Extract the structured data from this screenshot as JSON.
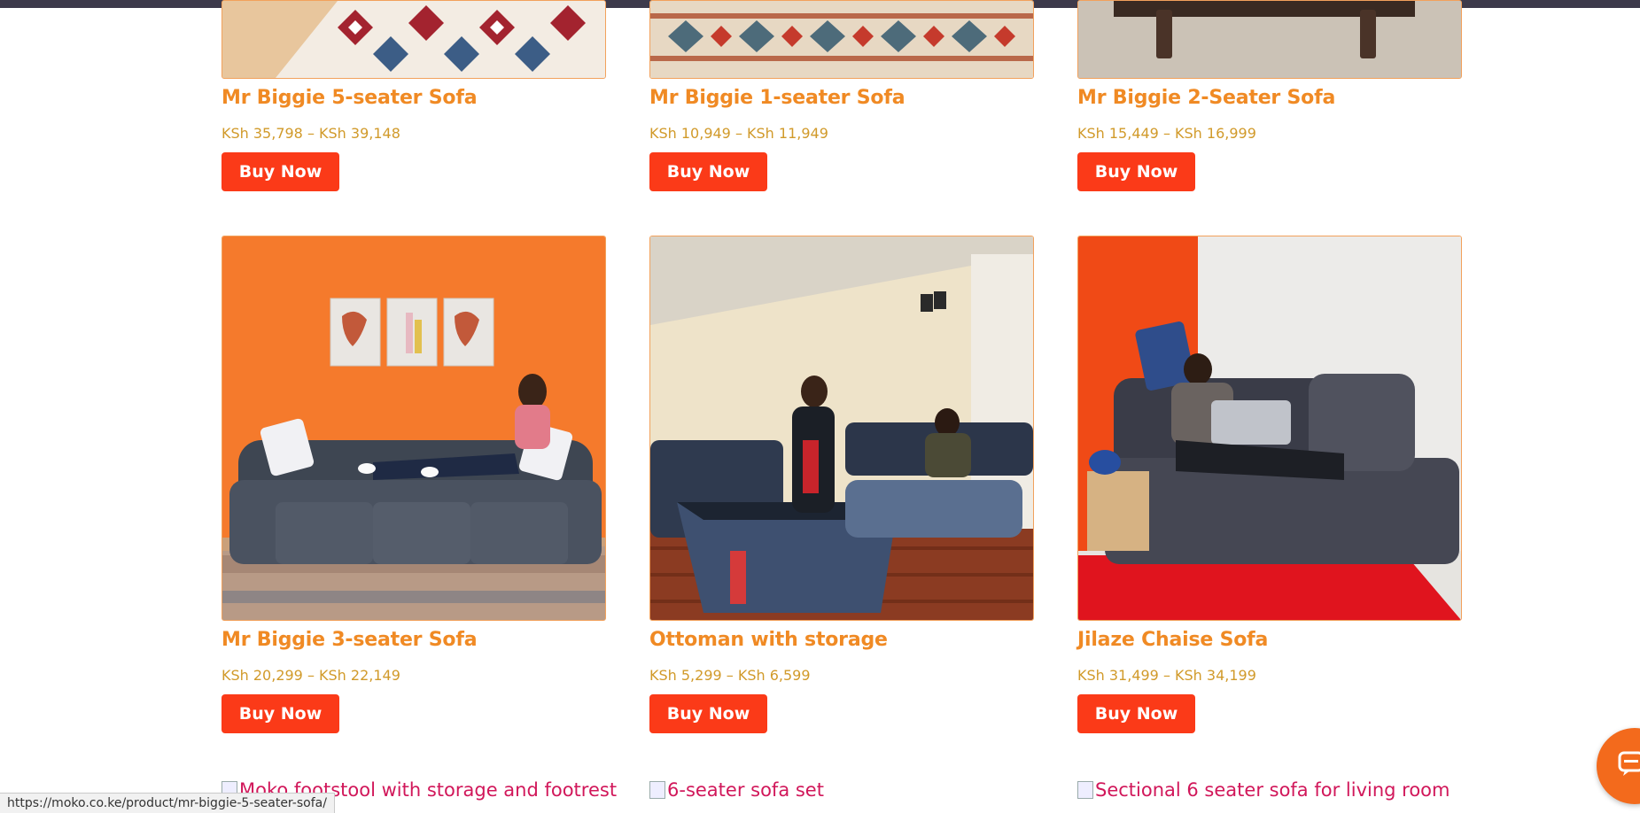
{
  "products": [
    {
      "title": "Mr Biggie 5-seater Sofa",
      "price": "KSh 35,798 – KSh 39,148",
      "button": "Buy Now"
    },
    {
      "title": "Mr Biggie 1-seater Sofa",
      "price": "KSh 10,949 – KSh 11,949",
      "button": "Buy Now"
    },
    {
      "title": "Mr Biggie 2-Seater Sofa",
      "price": "KSh 15,449 – KSh 16,999",
      "button": "Buy Now"
    },
    {
      "title": "Mr Biggie 3-seater Sofa",
      "price": "KSh 20,299 – KSh 22,149",
      "button": "Buy Now"
    },
    {
      "title": "Ottoman with storage",
      "price": "KSh 5,299 – KSh 6,599",
      "button": "Buy Now"
    },
    {
      "title": "Jilaze Chaise Sofa",
      "price": "KSh 31,499 – KSh 34,199",
      "button": "Buy Now"
    }
  ],
  "broken_images": [
    "Moko footstool with storage and footrest",
    "6-seater sofa set",
    "Sectional 6 seater sofa for living room"
  ],
  "status_url": "https://moko.co.ke/product/mr-biggie-5-seater-sofa/",
  "colors": {
    "title": "#f08a24",
    "price": "#d19a2a",
    "button": "#fb3a18",
    "accent_wall": "#f57a2c"
  },
  "icons": {
    "chat": "chat-bubble-icon"
  }
}
